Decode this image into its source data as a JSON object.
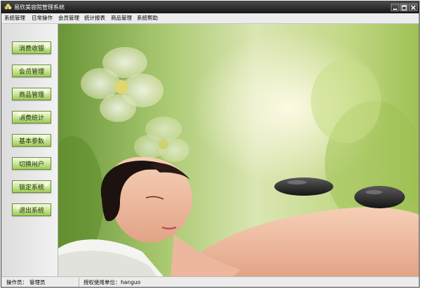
{
  "window": {
    "title": "易欣美容院管理系统",
    "controls": [
      "minimize",
      "maximize",
      "close"
    ]
  },
  "menu": {
    "items": [
      "系统管理",
      "日常操作",
      "会员管理",
      "统计报表",
      "商品管理",
      "系统帮助"
    ]
  },
  "sidebar": {
    "buttons": [
      "消费收银",
      "会员管理",
      "商品管理",
      "消费统计",
      "基本参数",
      "切换用户",
      "锁定系统",
      "退出系统"
    ]
  },
  "statusbar": {
    "operator_label": "操作员：",
    "operator_value": "管理员",
    "licensee_label": "授权使用单位：",
    "licensee_value": "hanguo"
  },
  "colors": {
    "titlebar": "#161616",
    "button_green": "#9dcb57",
    "button_border": "#6e8c3c"
  },
  "icons": {
    "app": "app-flower-icon",
    "minimize": "minimize-icon",
    "maximize": "maximize-icon",
    "close": "close-icon"
  }
}
